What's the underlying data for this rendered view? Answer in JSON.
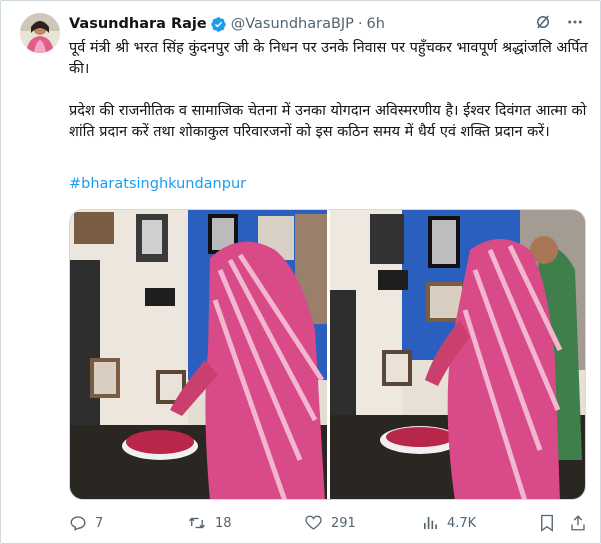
{
  "author": {
    "name": "Vasundhara Raje",
    "handle": "@VasundharaBJP",
    "separator": "·",
    "time": "6h"
  },
  "tweet": {
    "paragraph1": "पूर्व मंत्री श्री भरत सिंह कुंदनपुर जी के निधन पर उनके निवास पर पहुँचकर भावपूर्ण श्रद्धांजलि अर्पित की।",
    "paragraph2": "प्रदेश की राजनीतिक व सामाजिक चेतना में उनका योगदान अविस्मरणीय है। ईश्वर दिवंगत आत्मा को शांति प्रदान करें तथा शोकाकुल परिवारजनों को इस कठिन समय में धैर्य एवं शक्ति प्रदान करें।",
    "hashtag": "#bharatsinghkundanpur"
  },
  "stats": {
    "replies": "7",
    "reposts": "18",
    "likes": "291",
    "views": "4.7K"
  },
  "colors": {
    "accent": "#1d9bf0",
    "muted": "#536471",
    "border": "#cfd9de"
  },
  "icons": [
    "verified-badge-icon",
    "grok-icon",
    "more-icon",
    "reply-icon",
    "repost-icon",
    "like-icon",
    "views-icon",
    "bookmark-icon",
    "share-icon"
  ]
}
